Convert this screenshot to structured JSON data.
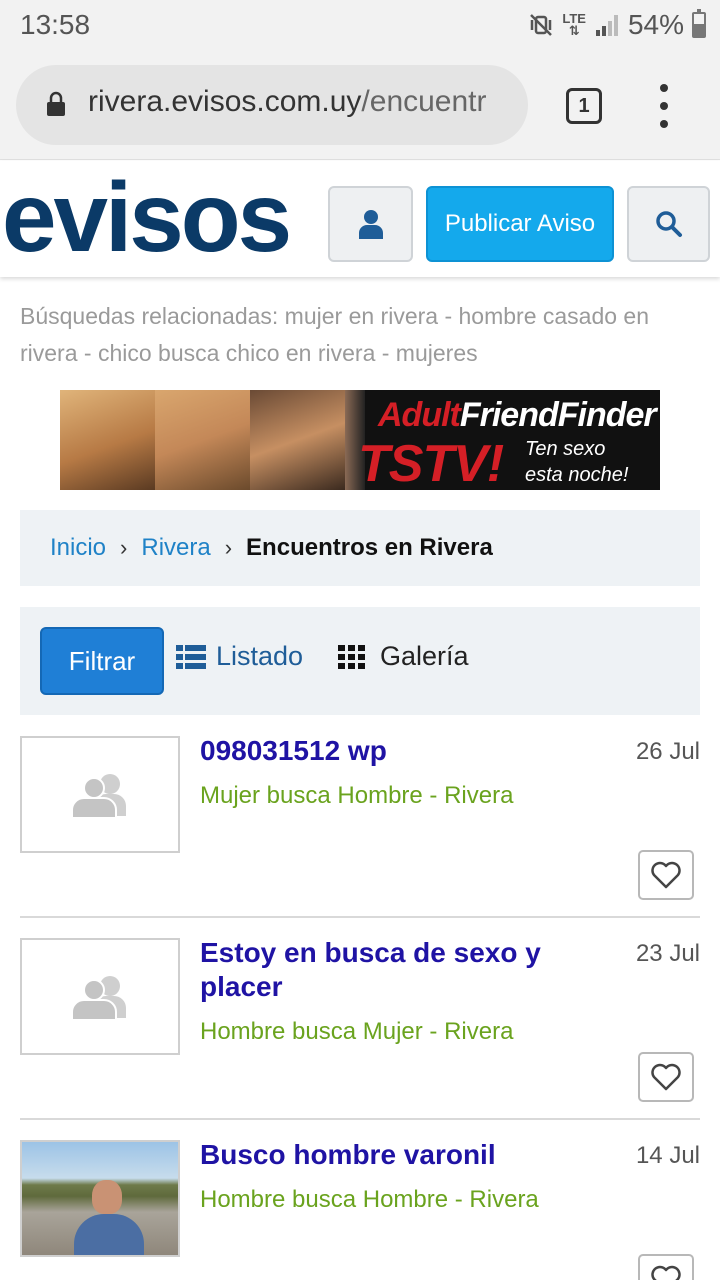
{
  "status_bar": {
    "time": "13:58",
    "network": "LTE",
    "battery": "54%"
  },
  "browser": {
    "url_domain": "rivera.evisos.com.uy",
    "url_path": "/encuentr",
    "tab_count": "1"
  },
  "header": {
    "logo": "evisos",
    "publish_label": "Publicar Aviso",
    "brand_color": "#0b3a67",
    "accent_color": "#14a9ec"
  },
  "related_searches": "Búsquedas relacionadas: mujer  en rivera - hombre casado en rivera - chico busca chico en rivera - mujeres",
  "banner": {
    "brand_a": "Adult",
    "brand_b": "FriendFinder",
    "headline": "TSTV!",
    "tagline_1": "Ten sexo",
    "tagline_2": "esta noche!"
  },
  "breadcrumb": {
    "home": "Inicio",
    "region": "Rivera",
    "current": "Encuentros en Rivera"
  },
  "filters": {
    "filter_label": "Filtrar",
    "list_label": "Listado",
    "gallery_label": "Galería"
  },
  "listings": [
    {
      "title": "098031512 wp",
      "category": "Mujer busca Hombre - Rivera",
      "date": "26 Jul"
    },
    {
      "title": "Estoy en busca de sexo y placer",
      "category": "Hombre busca Mujer - Rivera",
      "date": "23 Jul"
    },
    {
      "title": "Busco hombre varonil",
      "category": "Hombre busca Hombre - Rivera",
      "date": "14 Jul"
    }
  ]
}
